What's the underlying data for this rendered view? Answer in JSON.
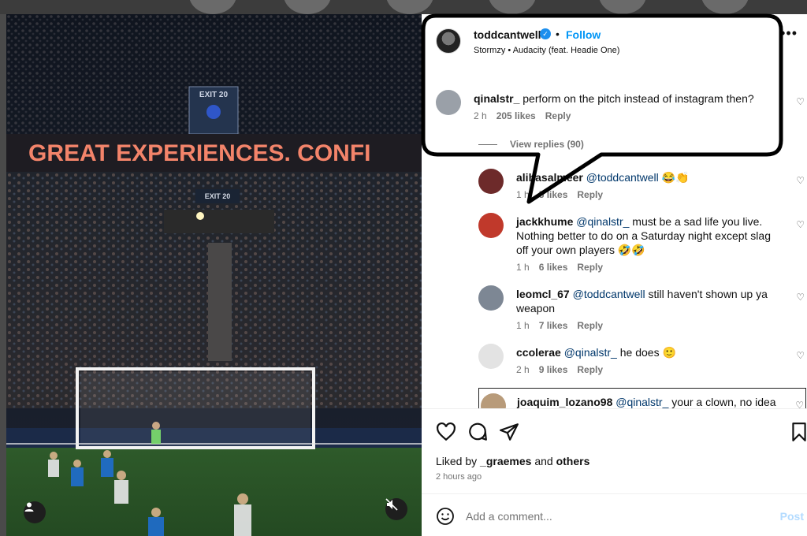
{
  "post": {
    "owner": "toddcantwell",
    "follow_label": "Follow",
    "separator": "•",
    "audio": "Stormzy • Audacity (feat. Headie One)",
    "more_label": "•••"
  },
  "media": {
    "banner_text": "GREAT EXPERIENCES. CONFI",
    "exit_sign_top": "EXIT 20",
    "exit_sign_bottom": "EXIT 20"
  },
  "comments": [
    {
      "user": "qinalstr_",
      "mention": "",
      "text": "perform on the pitch instead of instagram then?",
      "time": "2 h",
      "likes": "205 likes",
      "reply": "Reply"
    },
    {
      "user": "alihasalmeer",
      "mention": "@toddcantwell",
      "text": "😂👏",
      "time": "1 h",
      "likes": "5 likes",
      "reply": "Reply"
    },
    {
      "user": "jackkhume",
      "mention": "@qinalstr_",
      "text": "must be a sad life you live. Nothing better to do on a Saturday night except slag off your own players 🤣🤣",
      "time": "1 h",
      "likes": "6 likes",
      "reply": "Reply"
    },
    {
      "user": "leomcl_67",
      "mention": "@toddcantwell",
      "text": "still haven't shown up ya weapon",
      "time": "1 h",
      "likes": "7 likes",
      "reply": "Reply"
    },
    {
      "user": "ccolerae",
      "mention": "@qinalstr_",
      "text": "he does 🙂",
      "time": "2 h",
      "likes": "9 likes",
      "reply": "Reply"
    },
    {
      "user": "joaquim_lozano98",
      "mention": "@qinalstr_",
      "text": "your a clown, no idea about football, hes playing in a team full of donkeys",
      "time": "",
      "likes": "",
      "reply": ""
    }
  ],
  "view_replies": "View replies (90)",
  "liked_by": {
    "prefix": "Liked by ",
    "user": "_graemes",
    "mid": " and ",
    "others": "others"
  },
  "time_ago": "2 hours ago",
  "add_comment": {
    "placeholder": "Add a comment...",
    "post_label": "Post"
  },
  "colors": {
    "accent": "#0095f6",
    "verified": "#1d8fee",
    "banner": "#f07a5a",
    "pitch": "#2f5a2a"
  }
}
